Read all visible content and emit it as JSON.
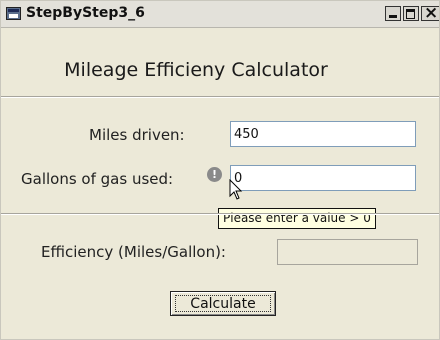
{
  "window": {
    "title": "StepByStep3_6"
  },
  "heading": "Mileage Efficieny Calculator",
  "fields": {
    "miles_label": "Miles driven:",
    "miles_value": "450",
    "gallons_label": "Gallons of gas used:",
    "gallons_value": "0",
    "efficiency_label": "Efficiency (Miles/Gallon):",
    "efficiency_value": ""
  },
  "validation": {
    "icon": "error-provider-icon",
    "icon_glyph": "!",
    "tooltip": "Please enter a value > 0"
  },
  "buttons": {
    "calculate": "Calculate"
  }
}
